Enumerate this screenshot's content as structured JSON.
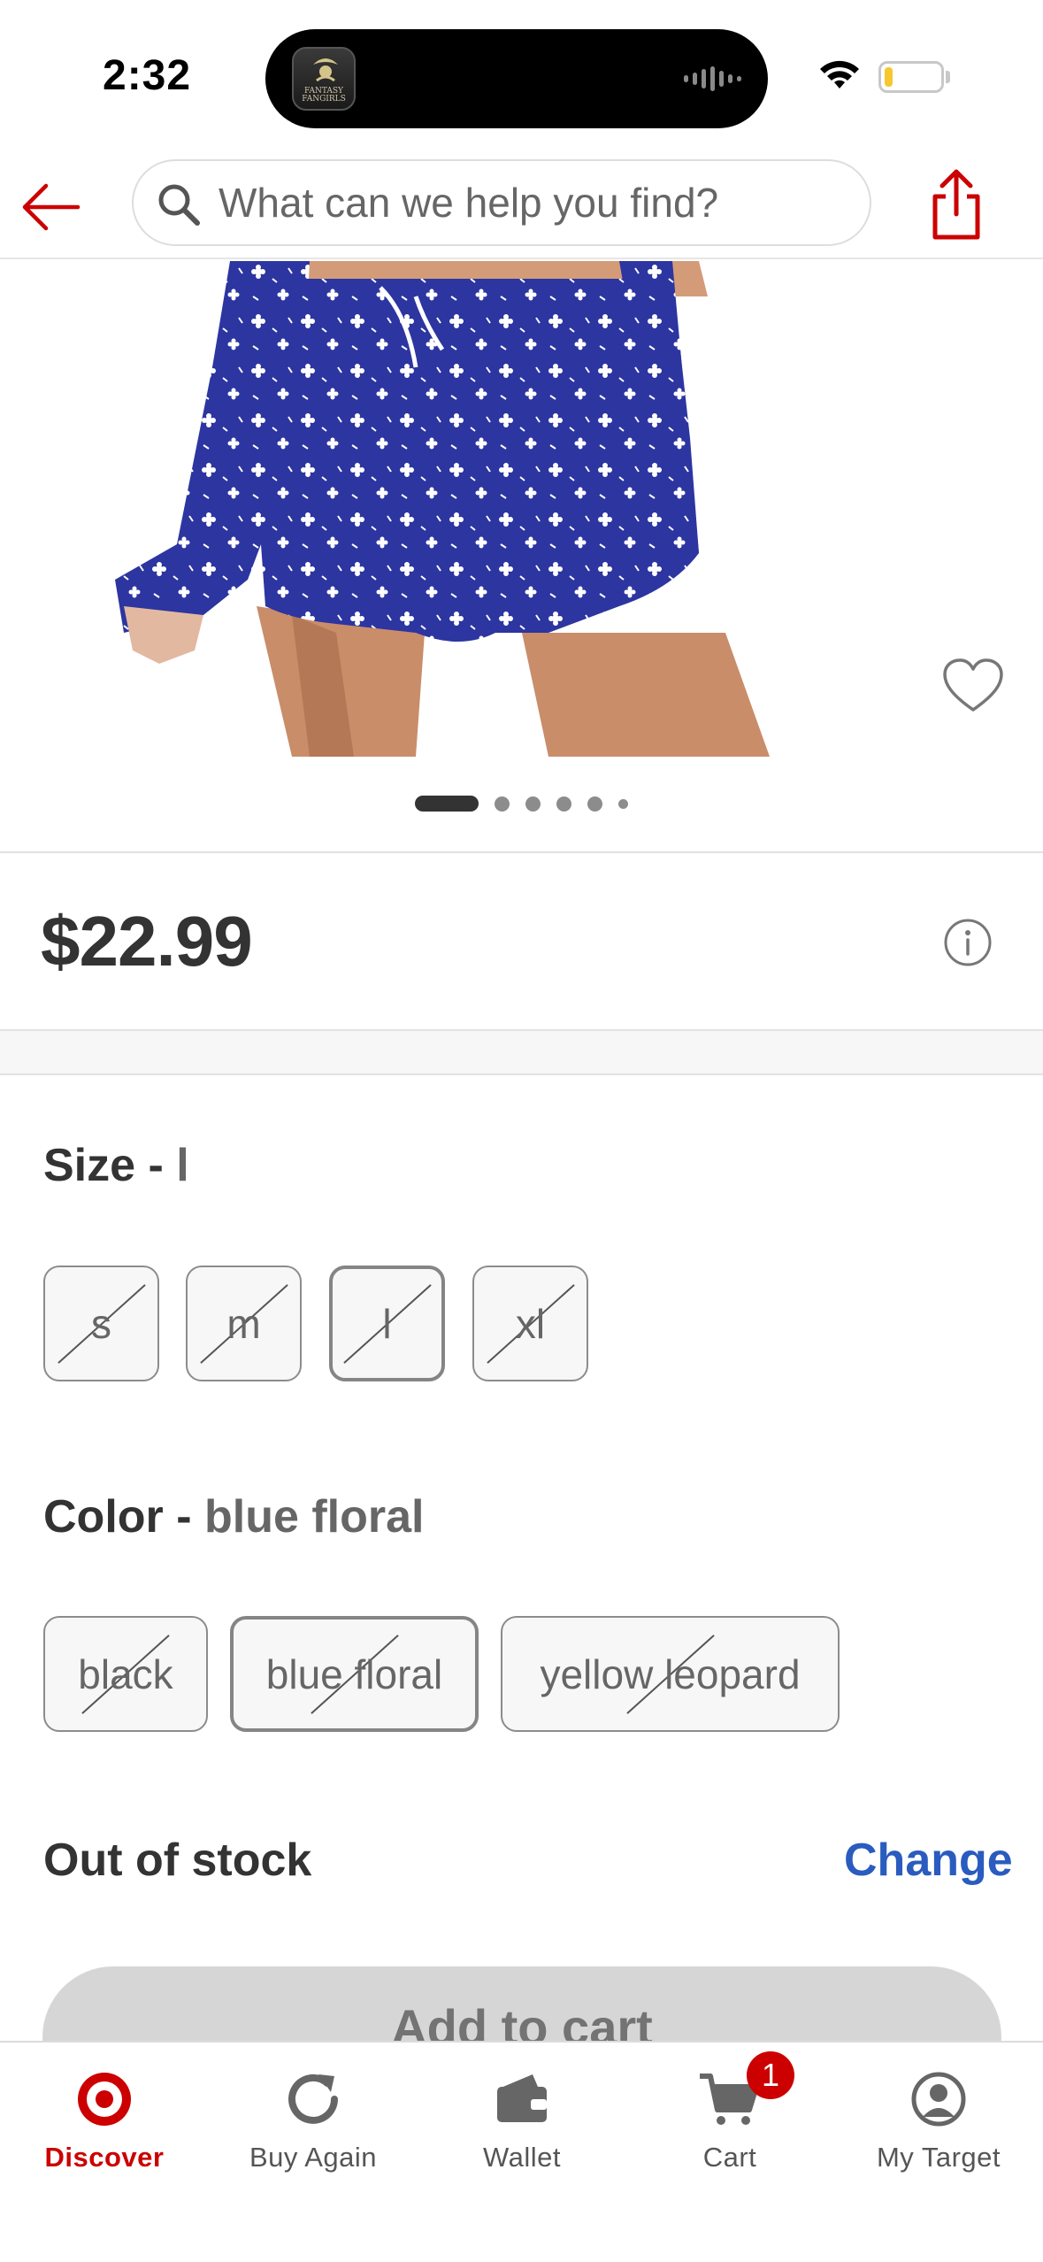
{
  "status_bar": {
    "time": "2:32",
    "island_app_text": "FANTASY FANGIRLS",
    "battery_level": 0.15
  },
  "header": {
    "back_icon": "arrow-left-icon",
    "search_placeholder": "What can we help you find?",
    "share_icon": "share-icon"
  },
  "product": {
    "image_count": 6,
    "active_image_index": 0,
    "price": "$22.99",
    "favorite_icon": "heart-outline-icon",
    "info_icon": "info-icon"
  },
  "size": {
    "label": "Size",
    "separator": " - ",
    "selected": "l",
    "options": [
      "s",
      "m",
      "l",
      "xl"
    ]
  },
  "color": {
    "label": "Color",
    "separator": " - ",
    "selected": "blue floral",
    "options": [
      "black",
      "blue floral",
      "yellow leopard"
    ]
  },
  "availability": {
    "status": "Out of stock",
    "change_label": "Change"
  },
  "add_to_cart_label": "Add to cart",
  "tab_bar": {
    "items": [
      {
        "label": "Discover",
        "icon": "target-logo-icon",
        "active": true
      },
      {
        "label": "Buy Again",
        "icon": "refresh-icon",
        "active": false
      },
      {
        "label": "Wallet",
        "icon": "wallet-icon",
        "active": false
      },
      {
        "label": "Cart",
        "icon": "cart-icon",
        "active": false
      },
      {
        "label": "My Target",
        "icon": "account-icon",
        "active": false
      }
    ],
    "cart_badge": "1"
  },
  "colors": {
    "brand_red": "#cc0000",
    "link_blue": "#2a5bbf",
    "text_dark": "#333333",
    "text_muted": "#666666",
    "fabric_blue": "#2c35a0"
  }
}
